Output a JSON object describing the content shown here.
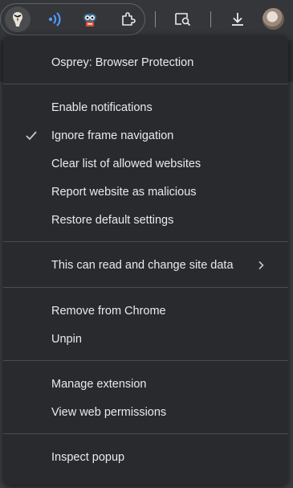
{
  "toolbar": {
    "icons": [
      {
        "name": "osprey-extension-icon",
        "active": true
      },
      {
        "name": "wifi-signal-extension-icon"
      },
      {
        "name": "robot-extension-icon"
      },
      {
        "name": "extensions-puzzle-icon"
      },
      {
        "name": "search-in-page-icon"
      },
      {
        "name": "download-icon"
      },
      {
        "name": "profile-avatar"
      }
    ]
  },
  "menu": {
    "header": "Osprey: Browser Protection",
    "group1": {
      "enable_notifications": "Enable notifications",
      "ignore_frame_navigation": "Ignore frame navigation",
      "ignore_frame_navigation_checked": true,
      "clear_allowed": "Clear list of allowed websites",
      "report_malicious": "Report website as malicious",
      "restore_defaults": "Restore default settings"
    },
    "site_access": "This can read and change site data",
    "group3": {
      "remove": "Remove from Chrome",
      "unpin": "Unpin"
    },
    "group4": {
      "manage": "Manage extension",
      "permissions": "View web permissions"
    },
    "inspect": "Inspect popup"
  },
  "colors": {
    "menu_bg": "#292a2d",
    "text": "#e8eaed",
    "divider": "#4a4c50",
    "accent_blue": "#4d9bff"
  }
}
